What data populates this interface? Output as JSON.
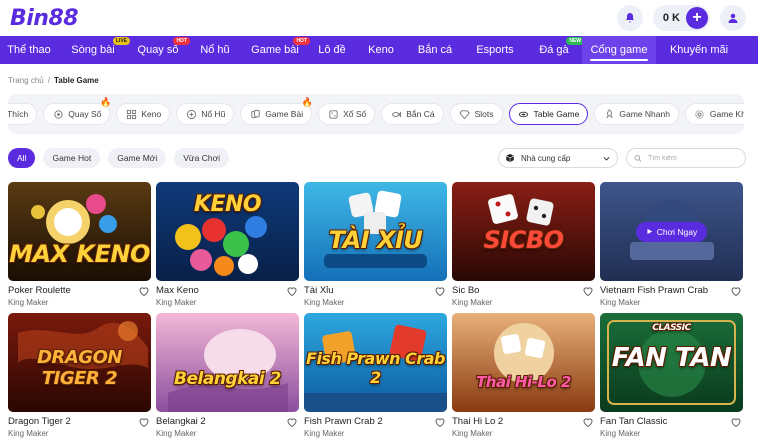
{
  "header": {
    "logo_text": "Bin88",
    "balance": "0 K",
    "plus_label": "+"
  },
  "nav": [
    {
      "label": "Thể thao",
      "badge": ""
    },
    {
      "label": "Sòng bài",
      "badge": "LIVE"
    },
    {
      "label": "Quay số",
      "badge": "HOT"
    },
    {
      "label": "Nổ hũ",
      "badge": ""
    },
    {
      "label": "Game bài",
      "badge": "HOT"
    },
    {
      "label": "Lô đề",
      "badge": ""
    },
    {
      "label": "Keno",
      "badge": ""
    },
    {
      "label": "Bắn cá",
      "badge": ""
    },
    {
      "label": "Esports",
      "badge": ""
    },
    {
      "label": "Đá gà",
      "badge": "NEW"
    },
    {
      "label": "Cổng game",
      "badge": "",
      "active": true
    },
    {
      "label": "Khuyến mãi",
      "badge": ""
    }
  ],
  "breadcrumb": {
    "home": "Trang chủ",
    "separator": "/",
    "current": "Table Game"
  },
  "categories": [
    {
      "label": "Thích",
      "icon": "heart-icon"
    },
    {
      "label": "Quay Số",
      "icon": "lottery-icon",
      "hot": true
    },
    {
      "label": "Keno",
      "icon": "keno-grid-icon"
    },
    {
      "label": "Nổ Hũ",
      "icon": "slot-jackpot-icon"
    },
    {
      "label": "Game Bài",
      "icon": "cards-icon",
      "hot": true
    },
    {
      "label": "Xổ Số",
      "icon": "dice-icon"
    },
    {
      "label": "Bắn Cá",
      "icon": "fish-icon"
    },
    {
      "label": "Slots",
      "icon": "diamond-icon"
    },
    {
      "label": "Table Game",
      "icon": "table-icon",
      "active": true
    },
    {
      "label": "Game Nhanh",
      "icon": "rocket-icon"
    },
    {
      "label": "Game Khác",
      "icon": "gear-icon"
    }
  ],
  "filters": {
    "chips": [
      "All",
      "Game Hot",
      "Game Mới",
      "Vừa Chơi"
    ],
    "provider_label": "Nhà cung cấp",
    "search_placeholder": "Tìm kiếm"
  },
  "play_button_label": "Chơi Ngay",
  "games": [
    {
      "name": "Poker Roulette",
      "provider": "King Maker",
      "art_title": "MAX KENO",
      "theme": "maxkeno"
    },
    {
      "name": "Max Keno",
      "provider": "King Maker",
      "art_title": "KENO",
      "theme": "keno"
    },
    {
      "name": "Tài Xỉu",
      "provider": "King Maker",
      "art_title": "TÀI XỈU",
      "theme": "taixiu"
    },
    {
      "name": "Sic Bo",
      "provider": "King Maker",
      "art_title": "SICBO",
      "theme": "sicbo"
    },
    {
      "name": "Vietnam Fish Prawn Crab",
      "provider": "King Maker",
      "art_title": "",
      "theme": "vietnam",
      "hover": true
    },
    {
      "name": "Dragon Tiger 2",
      "provider": "King Maker",
      "art_title": "DRAGON TIGER 2",
      "theme": "dragon"
    },
    {
      "name": "Belangkai 2",
      "provider": "King Maker",
      "art_title": "Belangkai 2",
      "theme": "belangkai"
    },
    {
      "name": "Fish Prawn Crab 2",
      "provider": "King Maker",
      "art_title": "Fish Prawn Crab 2",
      "theme": "fishprawn"
    },
    {
      "name": "Thai Hi Lo 2",
      "provider": "King Maker",
      "art_title": "Thai Hi-Lo 2",
      "theme": "thaihilo"
    },
    {
      "name": "Fan Tan Classic",
      "provider": "King Maker",
      "art_title": "FAN TAN",
      "art_subtitle": "CLASSIC",
      "theme": "fantan"
    }
  ],
  "colors": {
    "brand": "#5b2be0",
    "hot": "#f0323c",
    "live": "#e8c01a",
    "new": "#2dbb55"
  }
}
